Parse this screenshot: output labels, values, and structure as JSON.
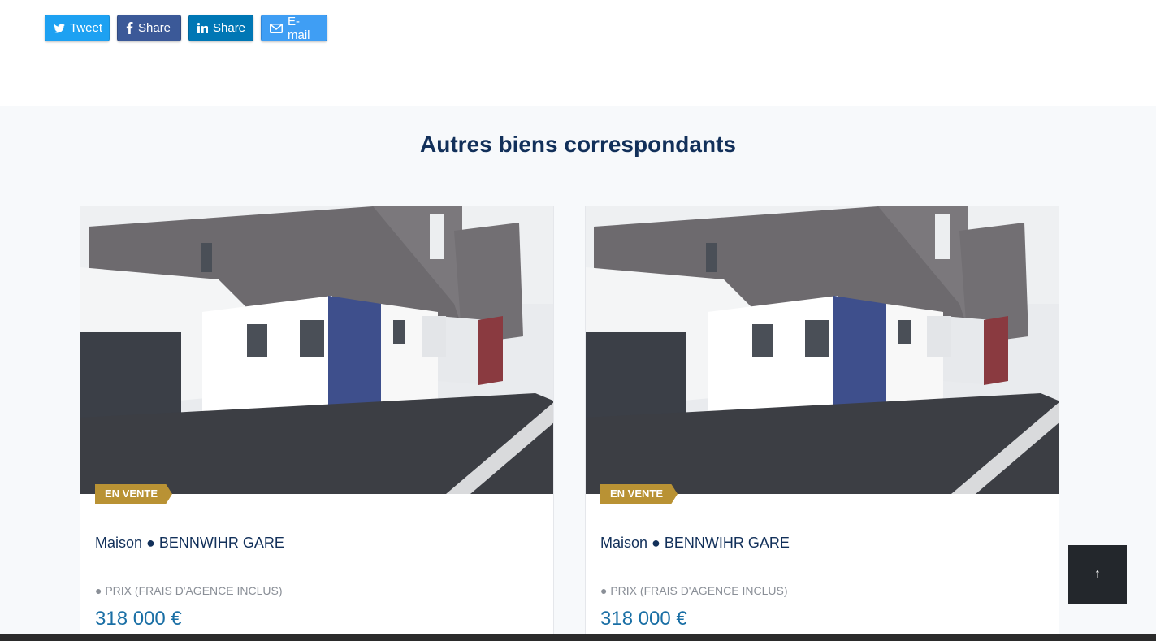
{
  "share": {
    "tweet_label": "Tweet",
    "facebook_label": "Share",
    "linkedin_label": "Share",
    "email_label": "E-mail"
  },
  "section": {
    "title": "Autres biens correspondants"
  },
  "listings": [
    {
      "badge": "EN VENTE",
      "title": "Maison ● BENNWIHR GARE",
      "price_label": "● PRIX (FRAIS D'AGENCE INCLUS)",
      "price": "318 000 €"
    },
    {
      "badge": "EN VENTE",
      "title": "Maison ● BENNWIHR GARE",
      "price_label": "● PRIX (FRAIS D'AGENCE INCLUS)",
      "price": "318 000 €"
    }
  ],
  "scroll_top": {
    "label": "↑"
  },
  "colors": {
    "twitter": "#1da1f2",
    "facebook": "#3b5998",
    "linkedin": "#0077b5",
    "email": "#3f9ef4",
    "badge": "#b99234",
    "title": "#12305a",
    "price": "#1a6fa5"
  }
}
